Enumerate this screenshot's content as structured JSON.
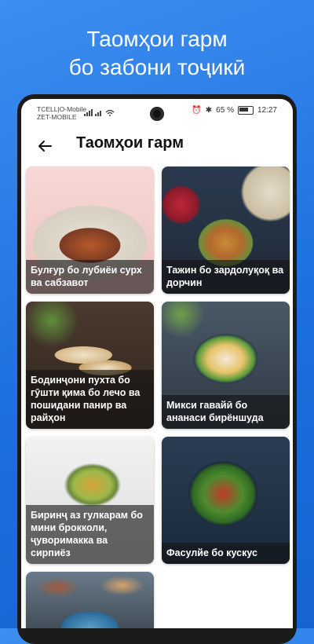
{
  "promo": {
    "line1": "Таомҳои гарм",
    "line2": "бо забони тоҷикӣ"
  },
  "status_bar": {
    "carrier1": "TCELL|O-Mobile",
    "carrier2": "ZET-MOBILE",
    "battery_percent": "65 %",
    "time": "12:27"
  },
  "header": {
    "title": "Таомҳои гарм",
    "back_icon": "arrow-left-icon"
  },
  "recipes": [
    {
      "label": "Булғур бо лубиёи сурх ва сабзавот"
    },
    {
      "label": "Тажин бо зардолуқоқ ва дорчин"
    },
    {
      "label": "Бодинҷони пухта бо гӯшти қима бо лечо ва пошидани панир ва райҳон"
    },
    {
      "label": "Микси гавайӣ бо ананаси бирёншуда"
    },
    {
      "label": "Биринҷ аз гулкарам бо мини брокколи, ҷуворимакка ва сирпиёз"
    },
    {
      "label": "Фасулйе бо кускус"
    },
    {
      "label": ""
    }
  ]
}
